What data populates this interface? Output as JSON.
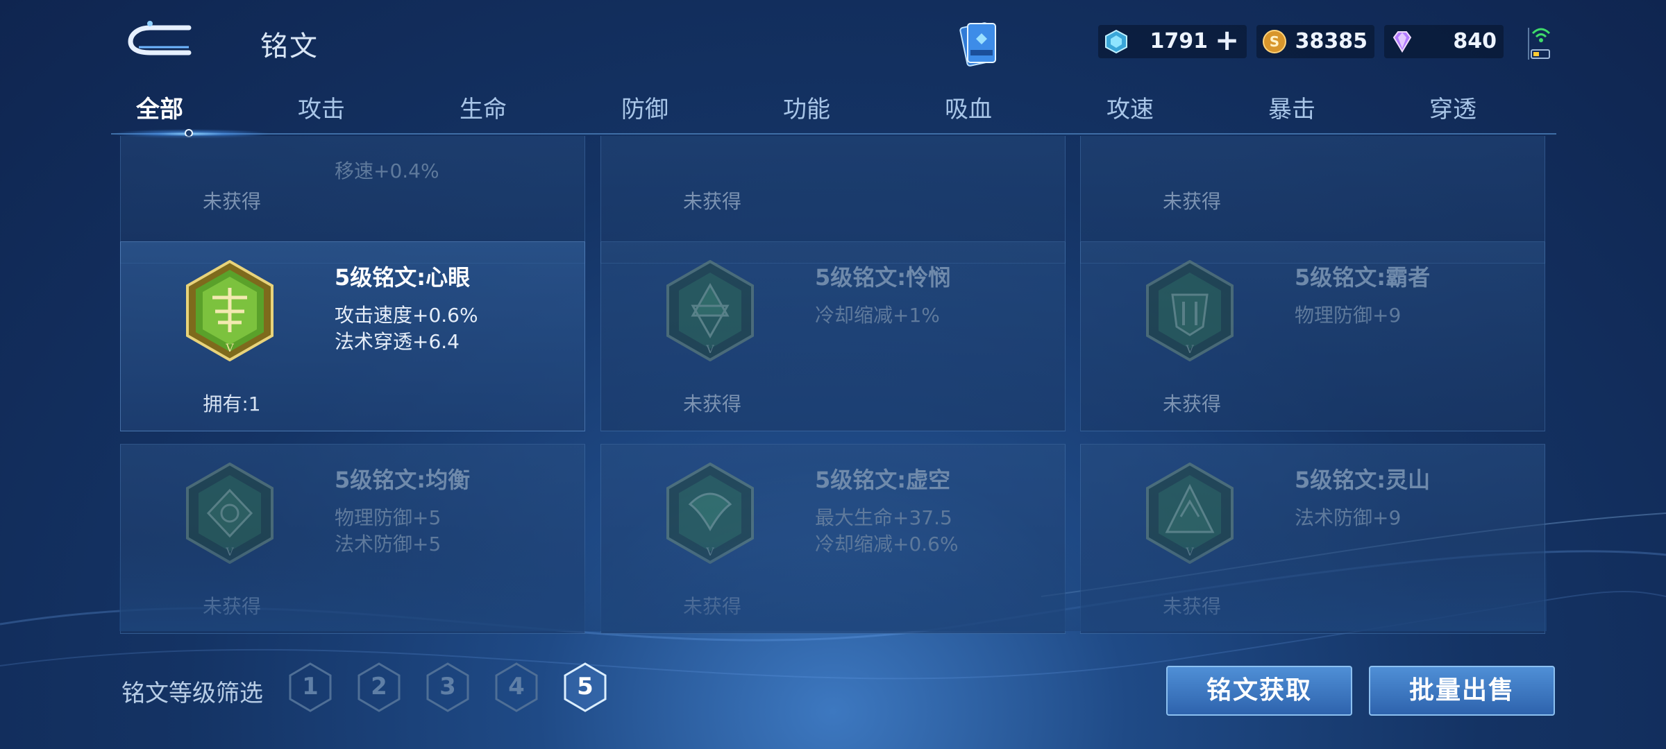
{
  "header": {
    "title": "铭文",
    "currencies": [
      {
        "icon": "diamond-coupon-icon",
        "value": "1791"
      },
      {
        "icon": "gold-coin-icon",
        "value": "38385"
      },
      {
        "icon": "purple-gem-icon",
        "value": "840"
      }
    ],
    "plus": "+"
  },
  "tabs": [
    "全部",
    "攻击",
    "生命",
    "防御",
    "功能",
    "吸血",
    "攻速",
    "暴击",
    "穿透"
  ],
  "active_tab": "全部",
  "rows": [
    {
      "cards": [
        {
          "attrs": [
            "移速+0.4%"
          ],
          "status": "未获得",
          "owned": false
        },
        {
          "attrs": [],
          "status": "未获得",
          "owned": false
        },
        {
          "attrs": [],
          "status": "未获得",
          "owned": false
        }
      ]
    },
    {
      "cards": [
        {
          "name": "5级铭文:心眼",
          "attrs": [
            "攻击速度+0.6%",
            "法术穿透+6.4"
          ],
          "status": "拥有:1",
          "owned": true,
          "emblem": "xinyan-inscription-icon"
        },
        {
          "name": "5级铭文:怜悯",
          "attrs": [
            "冷却缩减+1%"
          ],
          "status": "未获得",
          "owned": false,
          "emblem": "lianmin-inscription-icon"
        },
        {
          "name": "5级铭文:霸者",
          "attrs": [
            "物理防御+9"
          ],
          "status": "未获得",
          "owned": false,
          "emblem": "bazhe-inscription-icon"
        }
      ]
    },
    {
      "cards": [
        {
          "name": "5级铭文:均衡",
          "attrs": [
            "物理防御+5",
            "法术防御+5"
          ],
          "status": "未获得",
          "owned": false,
          "emblem": "junheng-inscription-icon"
        },
        {
          "name": "5级铭文:虚空",
          "attrs": [
            "最大生命+37.5",
            "冷却缩减+0.6%"
          ],
          "status": "未获得",
          "owned": false,
          "emblem": "xukong-inscription-icon"
        },
        {
          "name": "5级铭文:灵山",
          "attrs": [
            "法术防御+9"
          ],
          "status": "未获得",
          "owned": false,
          "emblem": "lingshan-inscription-icon"
        }
      ]
    }
  ],
  "footer": {
    "filter_label": "铭文等级筛选",
    "levels": [
      "1",
      "2",
      "3",
      "4",
      "5"
    ],
    "active_level": "5",
    "get_button": "铭文获取",
    "sell_button": "批量出售"
  },
  "colors": {
    "accent": "#4f8fd6",
    "owned_emblem": "#6fae3a",
    "locked_emblem": "#2f5a55"
  }
}
